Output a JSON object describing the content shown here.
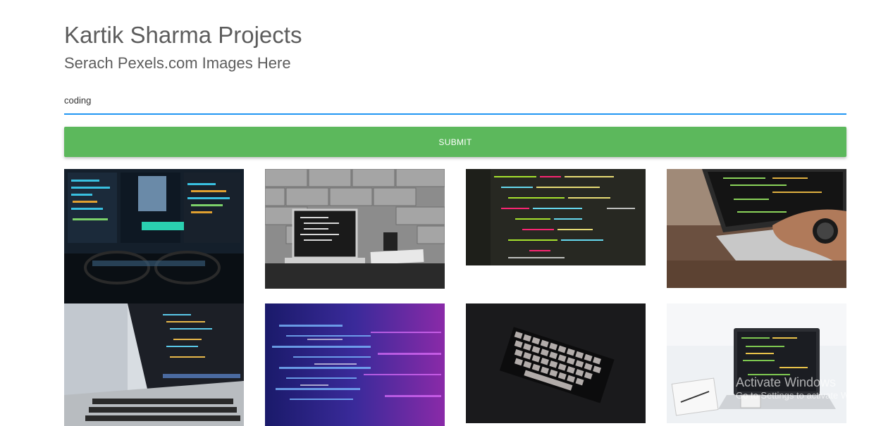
{
  "header": {
    "title": "Kartik Sharma Projects",
    "subtitle": "Serach Pexels.com Images Here"
  },
  "search": {
    "value": "coding",
    "accent_color": "#2196f3"
  },
  "submit": {
    "label": "SUBMIT",
    "color": "#5cb85c"
  },
  "results": [
    {
      "subject": "monitor with code and eyeglasses"
    },
    {
      "subject": "laptop on desk against brick wall, black and white"
    },
    {
      "subject": "colorful code on dark editor"
    },
    {
      "subject": "hands typing on laptop with code"
    },
    {
      "subject": "laptop keyboard with code on screen"
    },
    {
      "subject": "blurred blue and purple code streaks"
    },
    {
      "subject": "backlit keyboard in dark"
    },
    {
      "subject": "laptop with code on white desk with notebook and phone"
    }
  ],
  "watermark": {
    "title": "Activate Windows",
    "subtitle": "Go to Settings to activate Wi"
  }
}
